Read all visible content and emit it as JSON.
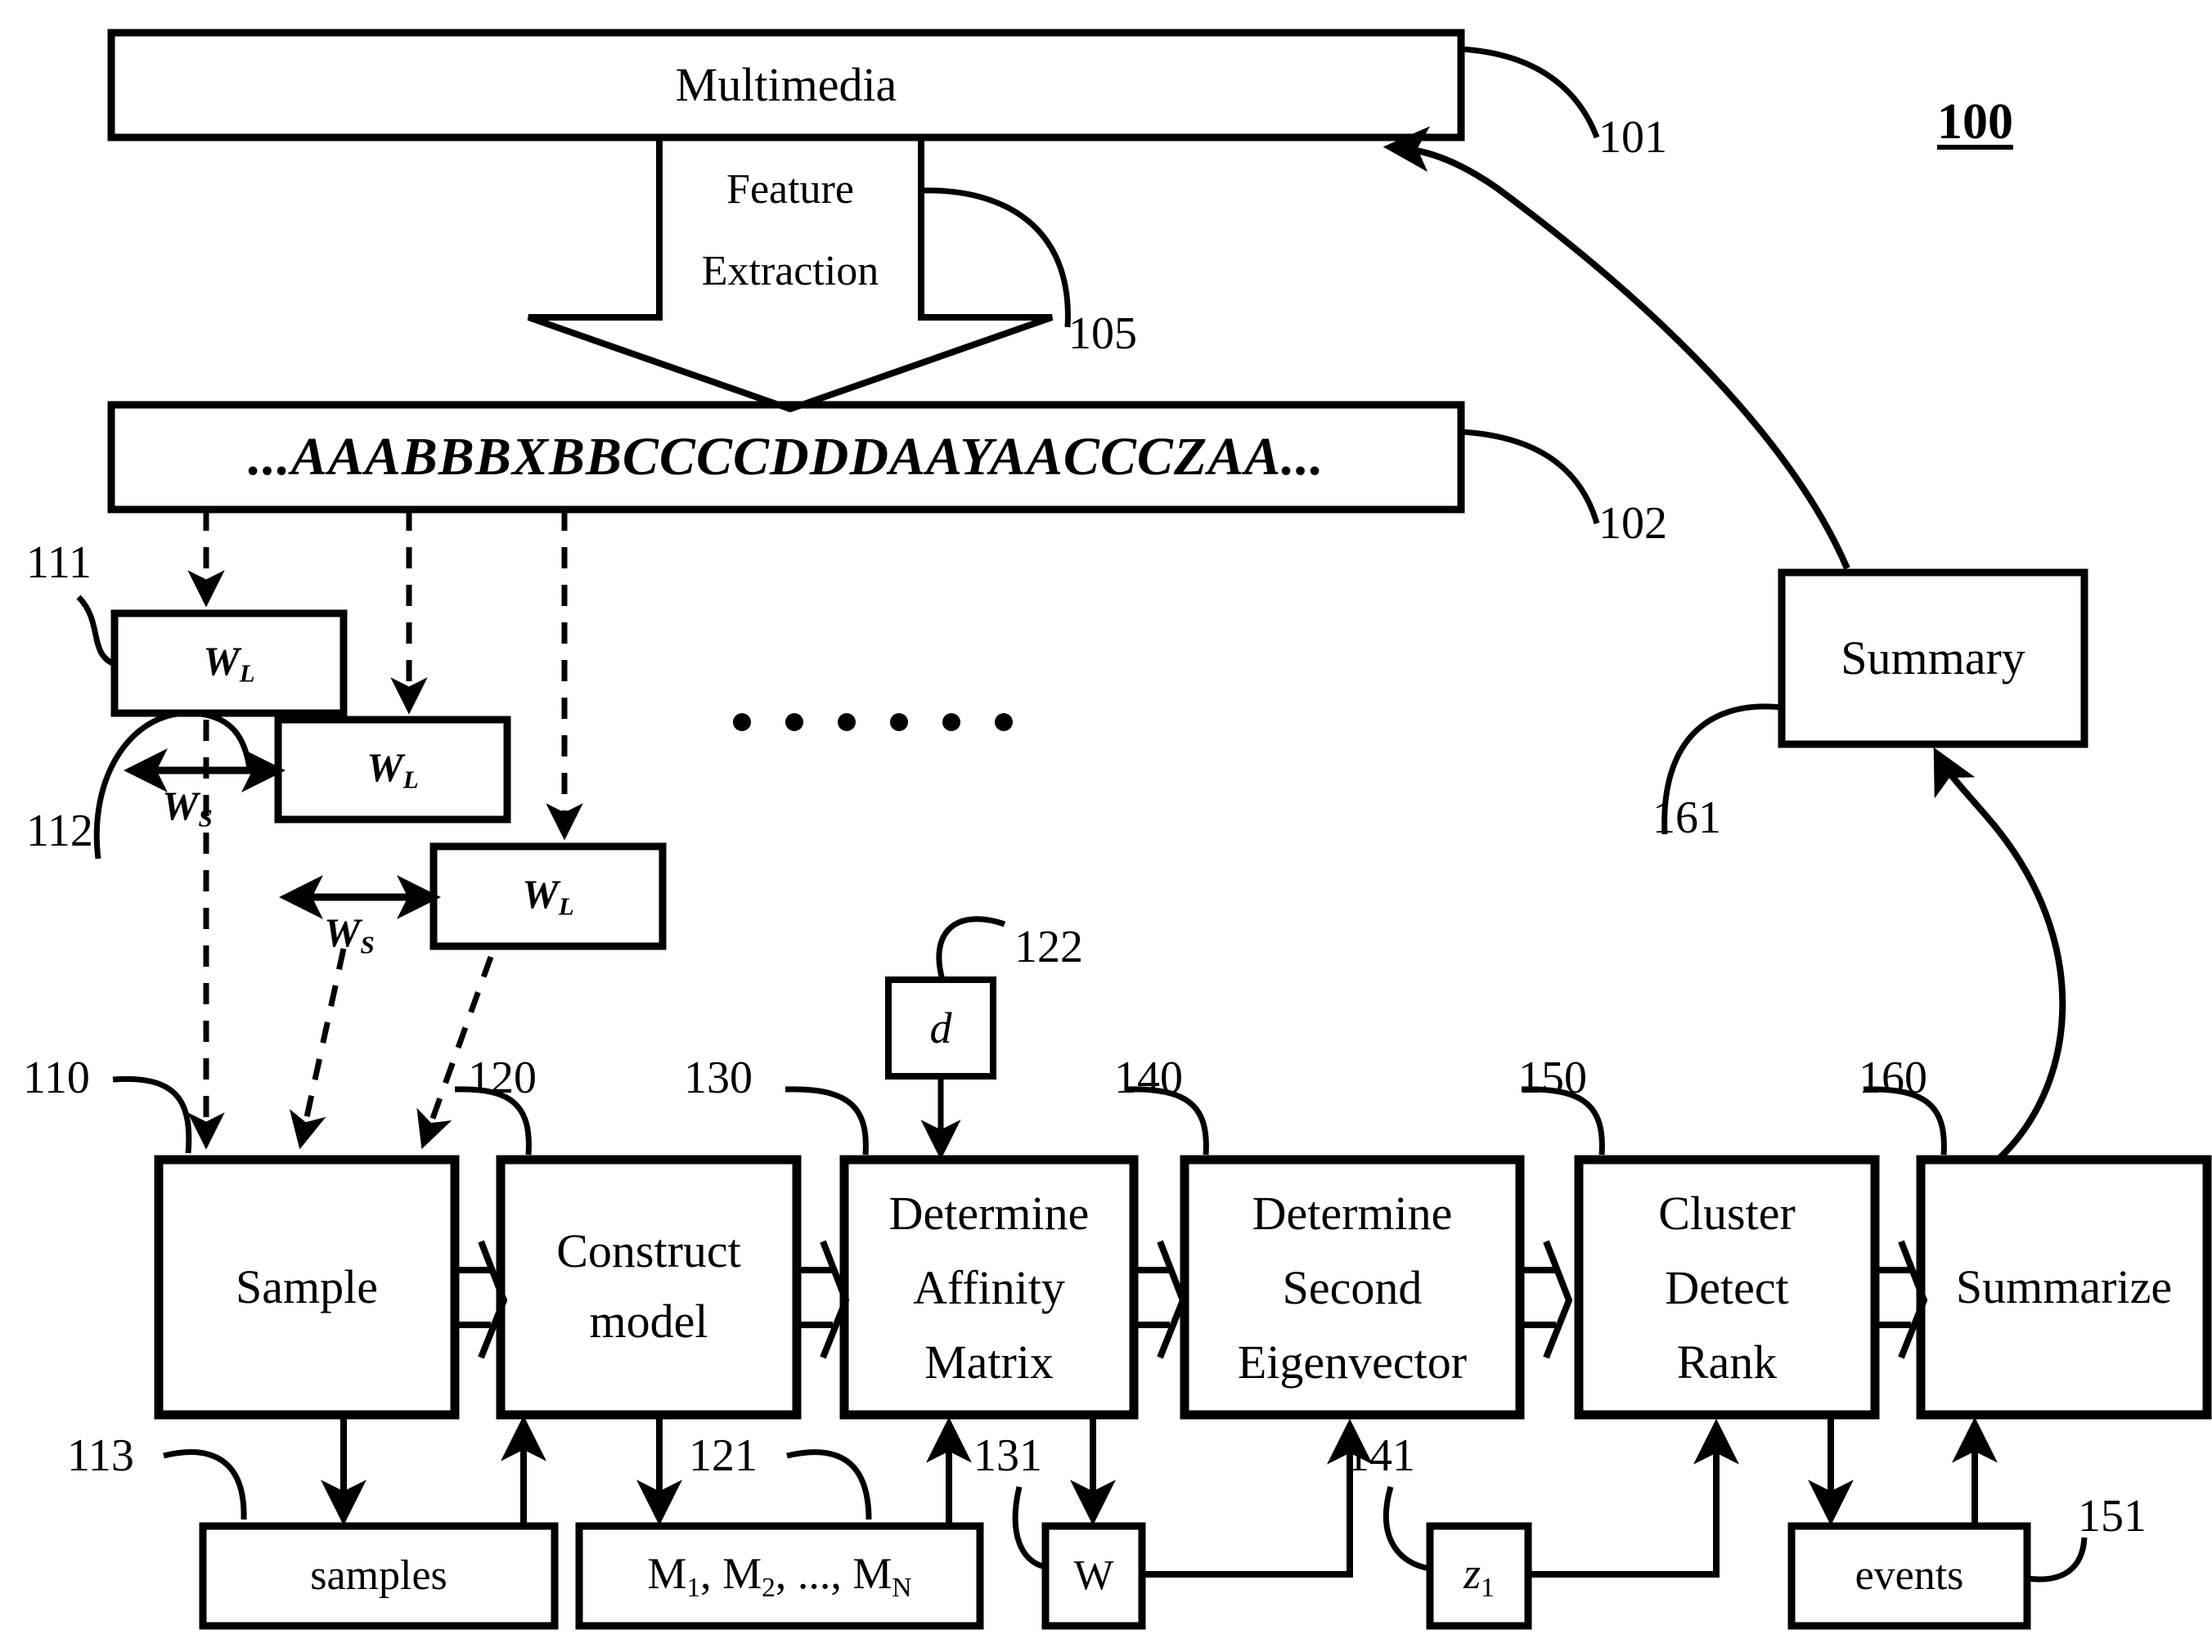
{
  "figure": {
    "title": "100",
    "symbol_sequence": "...AAABBBXBBCCCCDDDAAYAACCCZAA..."
  },
  "boxes": {
    "multimedia": "Multimedia",
    "feature_extraction_line1": "Feature",
    "feature_extraction_line2": "Extraction",
    "summary": "Summary",
    "window_long_1": "W",
    "window_long_1_sub": "L",
    "window_long_2": "W",
    "window_long_2_sub": "L",
    "window_long_3": "W",
    "window_long_3_sub": "L",
    "window_shift_1": "W",
    "window_shift_1_sub": "S",
    "window_shift_2": "W",
    "window_shift_2_sub": "S",
    "d_param": "d",
    "sample": "Sample",
    "construct_model_line1": "Construct",
    "construct_model_line2": "model",
    "determine_affinity_line1": "Determine",
    "determine_affinity_line2": "Affinity",
    "determine_affinity_line3": "Matrix",
    "determine_eigen_line1": "Determine",
    "determine_eigen_line2": "Second",
    "determine_eigen_line3": "Eigenvector",
    "cluster_line1": "Cluster",
    "cluster_line2": "Detect",
    "cluster_line3": "Rank",
    "summarize": "Summarize",
    "samples": "samples",
    "models": "M",
    "models_sub1": "1",
    "models_mid": ", M",
    "models_sub2": "2",
    "models_tail": ", ..., M",
    "models_subN": "N",
    "affinity_matrix_w": "W",
    "eigenvector_z": "z",
    "eigenvector_z_sub": "1",
    "events": "events"
  },
  "refs": {
    "r100": "100",
    "r101": "101",
    "r102": "102",
    "r105": "105",
    "r110": "110",
    "r111": "111",
    "r112": "112",
    "r113": "113",
    "r120": "120",
    "r121": "121",
    "r122": "122",
    "r130": "130",
    "r131": "131",
    "r140": "140",
    "r141": "141",
    "r150": "150",
    "r151": "151",
    "r160": "160",
    "r161": "161"
  },
  "colors": {
    "ink": "#000000",
    "paper": "#ffffff"
  }
}
